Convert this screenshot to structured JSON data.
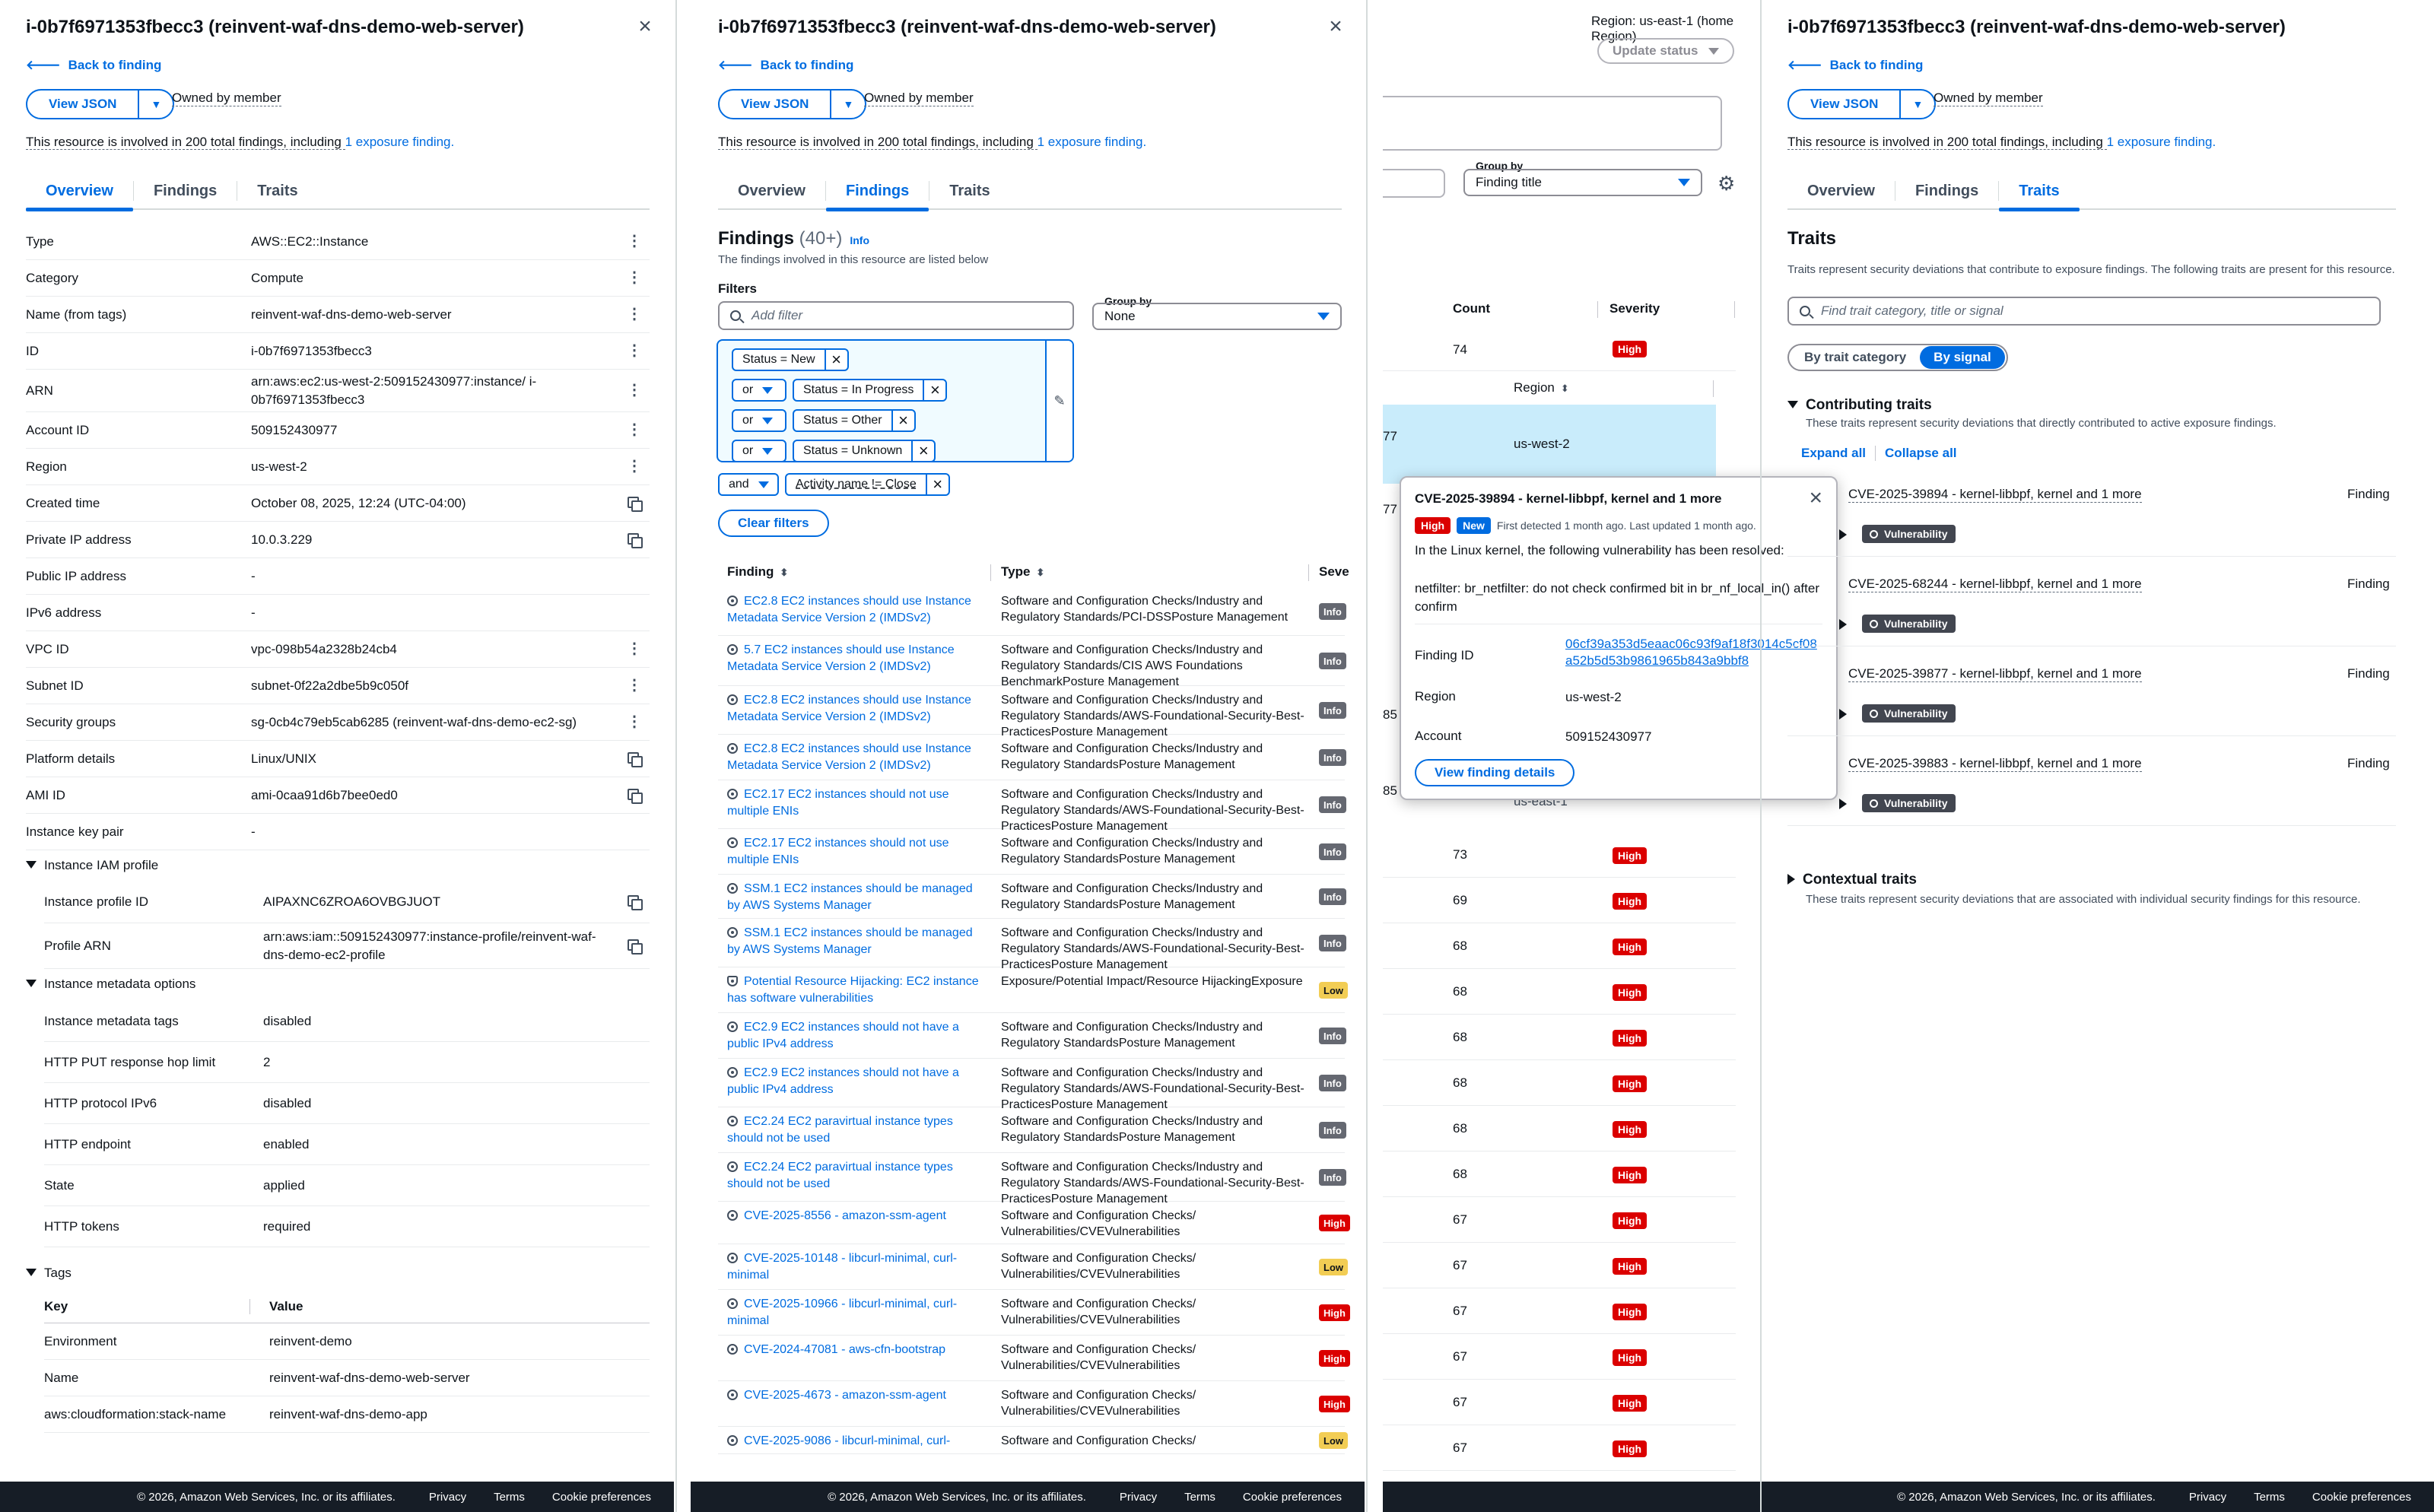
{
  "common": {
    "resource_title": "i-0b7f6971353fbecc3 (reinvent-waf-dns-demo-web-server)",
    "back_label": "Back to finding",
    "view_json": "View JSON",
    "owned_by": "Owned by member",
    "involved_pre": "This resource is involved in 200 total findings, including ",
    "involved_link": "1 exposure finding.",
    "tabs": [
      "Overview",
      "Findings",
      "Traits"
    ],
    "footer": {
      "copyright": "© 2026, Amazon Web Services, Inc. or its affiliates.",
      "privacy": "Privacy",
      "terms": "Terms",
      "cookies": "Cookie preferences"
    }
  },
  "overview": {
    "rows": [
      {
        "k": "Type",
        "v": "AWS::EC2::Instance"
      },
      {
        "k": "Category",
        "v": "Compute"
      },
      {
        "k": "Name (from tags)",
        "v": "reinvent-waf-dns-demo-web-server"
      },
      {
        "k": "ID",
        "v": "i-0b7f6971353fbecc3"
      },
      {
        "k": "ARN",
        "v": "arn:aws:ec2:us-west-2:509152430977:instance/ i-0b7f6971353fbecc3"
      },
      {
        "k": "Account ID",
        "v": "509152430977"
      },
      {
        "k": "Region",
        "v": "us-west-2"
      },
      {
        "k": "Created time",
        "v": "October 08, 2025, 12:24 (UTC-04:00)"
      },
      {
        "k": "Private IP address",
        "v": "10.0.3.229"
      },
      {
        "k": "Public IP address",
        "v": "-"
      },
      {
        "k": "IPv6 address",
        "v": "-"
      },
      {
        "k": "VPC ID",
        "v": "vpc-098b54a2328b24cb4"
      },
      {
        "k": "Subnet ID",
        "v": "subnet-0f22a2dbe5b9c050f"
      },
      {
        "k": "Security groups",
        "v": "sg-0cb4c79eb5cab6285 (reinvent-waf-dns-demo-ec2-sg)"
      },
      {
        "k": "Platform details",
        "v": "Linux/UNIX"
      },
      {
        "k": "AMI ID",
        "v": "ami-0caa91d6b7bee0ed0"
      },
      {
        "k": "Instance key pair",
        "v": "-"
      }
    ],
    "iam_section": "Instance IAM profile",
    "iam_rows": [
      {
        "k": "Instance profile ID",
        "v": "AIPAXNC6ZROA6OVBGJUOT"
      },
      {
        "k": "Profile ARN",
        "v": "arn:aws:iam::509152430977:instance-profile/reinvent-waf-dns-demo-ec2-profile"
      }
    ],
    "meta_section": "Instance metadata options",
    "meta_rows": [
      {
        "k": "Instance metadata tags",
        "v": "disabled"
      },
      {
        "k": "HTTP PUT response hop limit",
        "v": "2"
      },
      {
        "k": "HTTP protocol IPv6",
        "v": "disabled"
      },
      {
        "k": "HTTP endpoint",
        "v": "enabled"
      },
      {
        "k": "State",
        "v": "applied"
      },
      {
        "k": "HTTP tokens",
        "v": "required"
      }
    ],
    "tags_section": "Tags",
    "tags_header": {
      "key": "Key",
      "value": "Value"
    },
    "tags": [
      {
        "k": "Environment",
        "v": "reinvent-demo"
      },
      {
        "k": "Name",
        "v": "reinvent-waf-dns-demo-web-server"
      },
      {
        "k": "aws:cloudformation:stack-name",
        "v": "reinvent-waf-dns-demo-app"
      }
    ]
  },
  "findings": {
    "heading": "Findings",
    "count": "(40+)",
    "info": "Info",
    "subtitle": "The findings involved in this resource are listed below",
    "filters_label": "Filters",
    "add_filter_placeholder": "Add filter",
    "group_by_label": "Group by",
    "group_by_value": "None",
    "tokens": [
      {
        "op": "",
        "text": "Status = New"
      },
      {
        "op": "or",
        "text": "Status = In Progress"
      },
      {
        "op": "or",
        "text": "Status = Other"
      },
      {
        "op": "or",
        "text": "Status = Unknown"
      }
    ],
    "extra_token": {
      "op": "and",
      "text": "Activity name != Close"
    },
    "clear_filters": "Clear filters",
    "columns": {
      "finding": "Finding",
      "type": "Type",
      "severity": "Seve"
    },
    "rows": [
      {
        "icon": "c",
        "name": "EC2.8 EC2 instances should use Instance Metadata Service Version 2 (IMDSv2)",
        "type": "Software and Configuration Checks/Industry and Regulatory Standards/PCI-DSSPosture Management",
        "sev": "Info"
      },
      {
        "icon": "c",
        "name": "5.7 EC2 instances should use Instance Metadata Service Version 2 (IMDSv2)",
        "type": "Software and Configuration Checks/Industry and Regulatory Standards/CIS AWS Foundations BenchmarkPosture Management",
        "sev": "Info"
      },
      {
        "icon": "c",
        "name": "EC2.8 EC2 instances should use Instance Metadata Service Version 2 (IMDSv2)",
        "type": "Software and Configuration Checks/Industry and Regulatory Standards/AWS-Foundational-Security-Best-PracticesPosture Management",
        "sev": "Info"
      },
      {
        "icon": "c",
        "name": "EC2.8 EC2 instances should use Instance Metadata Service Version 2 (IMDSv2)",
        "type": "Software and Configuration Checks/Industry and Regulatory StandardsPosture Management",
        "sev": "Info"
      },
      {
        "icon": "c",
        "name": "EC2.17 EC2 instances should not use multiple ENIs",
        "type": "Software and Configuration Checks/Industry and Regulatory Standards/AWS-Foundational-Security-Best-PracticesPosture Management",
        "sev": "Info"
      },
      {
        "icon": "c",
        "name": "EC2.17 EC2 instances should not use multiple ENIs",
        "type": "Software and Configuration Checks/Industry and Regulatory StandardsPosture Management",
        "sev": "Info"
      },
      {
        "icon": "c",
        "name": "SSM.1 EC2 instances should be managed by AWS Systems Manager",
        "type": "Software and Configuration Checks/Industry and Regulatory StandardsPosture Management",
        "sev": "Info"
      },
      {
        "icon": "c",
        "name": "SSM.1 EC2 instances should be managed by AWS Systems Manager",
        "type": "Software and Configuration Checks/Industry and Regulatory Standards/AWS-Foundational-Security-Best-PracticesPosture Management",
        "sev": "Info"
      },
      {
        "icon": "s",
        "name": "Potential Resource Hijacking: EC2 instance has software vulnerabilities",
        "type": "Exposure/Potential Impact/Resource HijackingExposure",
        "sev": "Low"
      },
      {
        "icon": "c",
        "name": "EC2.9 EC2 instances should not have a public IPv4 address",
        "type": "Software and Configuration Checks/Industry and Regulatory StandardsPosture Management",
        "sev": "Info"
      },
      {
        "icon": "c",
        "name": "EC2.9 EC2 instances should not have a public IPv4 address",
        "type": "Software and Configuration Checks/Industry and Regulatory Standards/AWS-Foundational-Security-Best-PracticesPosture Management",
        "sev": "Info"
      },
      {
        "icon": "c",
        "name": "EC2.24 EC2 paravirtual instance types should not be used",
        "type": "Software and Configuration Checks/Industry and Regulatory StandardsPosture Management",
        "sev": "Info"
      },
      {
        "icon": "c",
        "name": "EC2.24 EC2 paravirtual instance types should not be used",
        "type": "Software and Configuration Checks/Industry and Regulatory Standards/AWS-Foundational-Security-Best-PracticesPosture Management",
        "sev": "Info"
      },
      {
        "icon": "m",
        "name": "CVE-2025-8556 - amazon-ssm-agent",
        "type": "Software and Configuration Checks/ Vulnerabilities/CVEVulnerabilities",
        "sev": "High"
      },
      {
        "icon": "m",
        "name": "CVE-2025-10148 - libcurl-minimal, curl-minimal",
        "type": "Software and Configuration Checks/ Vulnerabilities/CVEVulnerabilities",
        "sev": "Low"
      },
      {
        "icon": "m",
        "name": "CVE-2025-10966 - libcurl-minimal, curl-minimal",
        "type": "Software and Configuration Checks/ Vulnerabilities/CVEVulnerabilities",
        "sev": "High"
      },
      {
        "icon": "m",
        "name": "CVE-2024-47081 - aws-cfn-bootstrap",
        "type": "Software and Configuration Checks/ Vulnerabilities/CVEVulnerabilities",
        "sev": "High"
      },
      {
        "icon": "m",
        "name": "CVE-2025-4673 - amazon-ssm-agent",
        "type": "Software and Configuration Checks/ Vulnerabilities/CVEVulnerabilities",
        "sev": "High"
      },
      {
        "icon": "m",
        "name": "CVE-2025-9086 - libcurl-minimal, curl-",
        "type": "Software and Configuration Checks/",
        "sev": "Low"
      }
    ]
  },
  "list": {
    "region_label": "Region: us-east-1 (home Region)",
    "update_status": "Update status",
    "group_by_label": "Group by",
    "group_by_value": "Finding title",
    "columns": {
      "count": "Count",
      "severity": "Severity",
      "region": "Region"
    },
    "top_count": "74",
    "top_sev": "High",
    "selected_region": "us-west-2",
    "selected_prefix": "77",
    "side_77": "77",
    "side_85a": "85",
    "side_85b": "85",
    "partial_region": "us-east-1",
    "rows": [
      {
        "c": "73",
        "s": "High"
      },
      {
        "c": "69",
        "s": "High"
      },
      {
        "c": "68",
        "s": "High"
      },
      {
        "c": "68",
        "s": "High"
      },
      {
        "c": "68",
        "s": "High"
      },
      {
        "c": "68",
        "s": "High"
      },
      {
        "c": "68",
        "s": "High"
      },
      {
        "c": "68",
        "s": "High"
      },
      {
        "c": "67",
        "s": "High"
      },
      {
        "c": "67",
        "s": "High"
      },
      {
        "c": "67",
        "s": "High"
      },
      {
        "c": "67",
        "s": "High"
      },
      {
        "c": "67",
        "s": "High"
      },
      {
        "c": "67",
        "s": "High"
      }
    ]
  },
  "popover": {
    "title": "CVE-2025-39894 - kernel-libbpf, kernel and 1 more",
    "badge_sev": "High",
    "badge_new": "New",
    "detected": "First detected 1 month ago. Last updated 1 month ago.",
    "desc1": "In the Linux kernel, the following vulnerability has been resolved:",
    "desc2": "netfilter: br_netfilter: do not check confirmed bit in br_nf_local_in() after confirm",
    "finding_id_label": "Finding ID",
    "finding_id": "06cf39a353d5eaac06c93f9af18f3014c5cf08a52b5d53b9861965b843a9bbf8",
    "region_label": "Region",
    "region": "us-west-2",
    "account_label": "Account",
    "account": "509152430977",
    "button": "View finding details"
  },
  "traits": {
    "heading": "Traits",
    "subtitle": "Traits represent security deviations that contribute to exposure findings. The following traits are present for this resource.",
    "search_placeholder": "Find trait category, title or signal",
    "seg": [
      "By trait category",
      "By signal"
    ],
    "contributing": "Contributing traits",
    "contributing_desc": "These traits represent security deviations that directly contributed to active exposure findings.",
    "expand_all": "Expand all",
    "collapse_all": "Collapse all",
    "items": [
      {
        "title": "CVE-2025-39894 - kernel-libbpf, kernel and 1 more",
        "kind": "Finding",
        "badge": "Vulnerability"
      },
      {
        "title": "CVE-2025-68244 - kernel-libbpf, kernel and 1 more",
        "kind": "Finding",
        "badge": "Vulnerability"
      },
      {
        "title": "CVE-2025-39877 - kernel-libbpf, kernel and 1 more",
        "kind": "Finding",
        "badge": "Vulnerability"
      },
      {
        "title": "CVE-2025-39883 - kernel-libbpf, kernel and 1 more",
        "kind": "Finding",
        "badge": "Vulnerability"
      }
    ],
    "contextual": "Contextual traits",
    "contextual_desc": "These traits represent security deviations that are associated with individual security findings for this resource."
  }
}
